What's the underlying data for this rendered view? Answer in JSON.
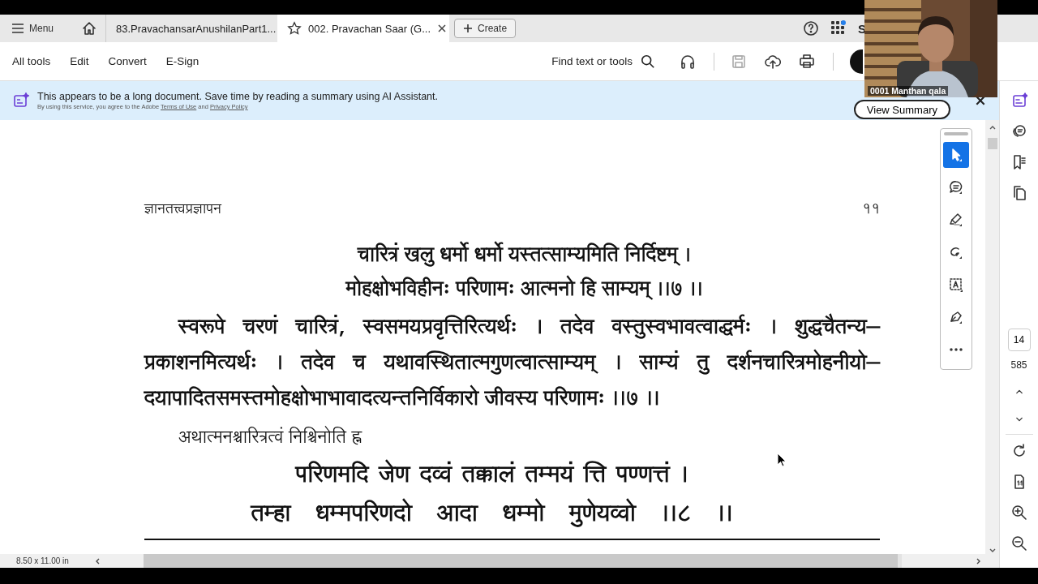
{
  "tabs_bar": {
    "menu": "Menu",
    "tabs": [
      {
        "label": "83.PravachansarAnushilanPart1...",
        "selected": false,
        "starred": false
      },
      {
        "label": "002. Pravachan Saar (G...",
        "selected": true,
        "starred": true
      }
    ],
    "create": "Create",
    "partial_button": "S"
  },
  "toolbar": {
    "menus": [
      "All tools",
      "Edit",
      "Convert",
      "E-Sign"
    ],
    "search": "Find text or tools"
  },
  "banner": {
    "message": "This appears to be a long document. Save time by reading a summary using AI Assistant.",
    "notice": "By using this service, you agree to the Adobe",
    "terms": "Terms of Use",
    "and": "and",
    "privacy": "Privacy Policy",
    "button": "View Summary"
  },
  "video": {
    "caption": "0001 Manthan qala"
  },
  "document": {
    "header": "ज्ञानतत्त्वप्रज्ञापन",
    "page_number": "११",
    "blocks": [
      {
        "kind": "verse",
        "lines": [
          "चारित्रं खलु धर्मो धर्मो यस्तत्साम्यमिति निर्दिष्टम् ।",
          "मोहक्षोभविहीनः परिणामः आत्मनो हि साम्यम् ।।७ ।।"
        ]
      },
      {
        "kind": "prose",
        "lines": [
          "स्वरूपे चरणं चारित्रं, स्वसमयप्रवृत्तिरित्यर्थः । तदेव वस्तुस्वभावत्वाद्धर्मः । शुद्धचैतन्य–",
          "प्रकाशनमित्यर्थः । तदेव च यथावस्थितात्मगुणत्वात्साम्यम् । साम्यं तु दर्शनचारित्रमोहनीयो–",
          "दयापादितसमस्तमोहक्षोभाभावादत्यन्तनिर्विकारो जीवस्य परिणामः ।।७ ।।"
        ]
      },
      {
        "kind": "heading",
        "lines": [
          "अथात्मनश्चारित्रत्वं निश्चिनोति ह्न"
        ]
      },
      {
        "kind": "gatha",
        "lines": [
          "परिणमदि जेण दव्वं तक्कालं तम्मयं त्ति पण्णत्तं ।",
          "तम्हा धम्मपरिणदो आदा धम्मो मुणेयव्वो ।।८ ।।"
        ]
      }
    ]
  },
  "tools": [
    {
      "kind": "select",
      "selected": true
    },
    {
      "kind": "comment",
      "selected": false
    },
    {
      "kind": "highlight",
      "selected": false
    },
    {
      "kind": "draw",
      "selected": false
    },
    {
      "kind": "textbox",
      "selected": false
    },
    {
      "kind": "sign",
      "selected": false
    },
    {
      "kind": "more",
      "selected": false
    }
  ],
  "page_nav": {
    "current": "14",
    "total": "585"
  },
  "status": {
    "size": "8.50 x 11.00 in"
  }
}
